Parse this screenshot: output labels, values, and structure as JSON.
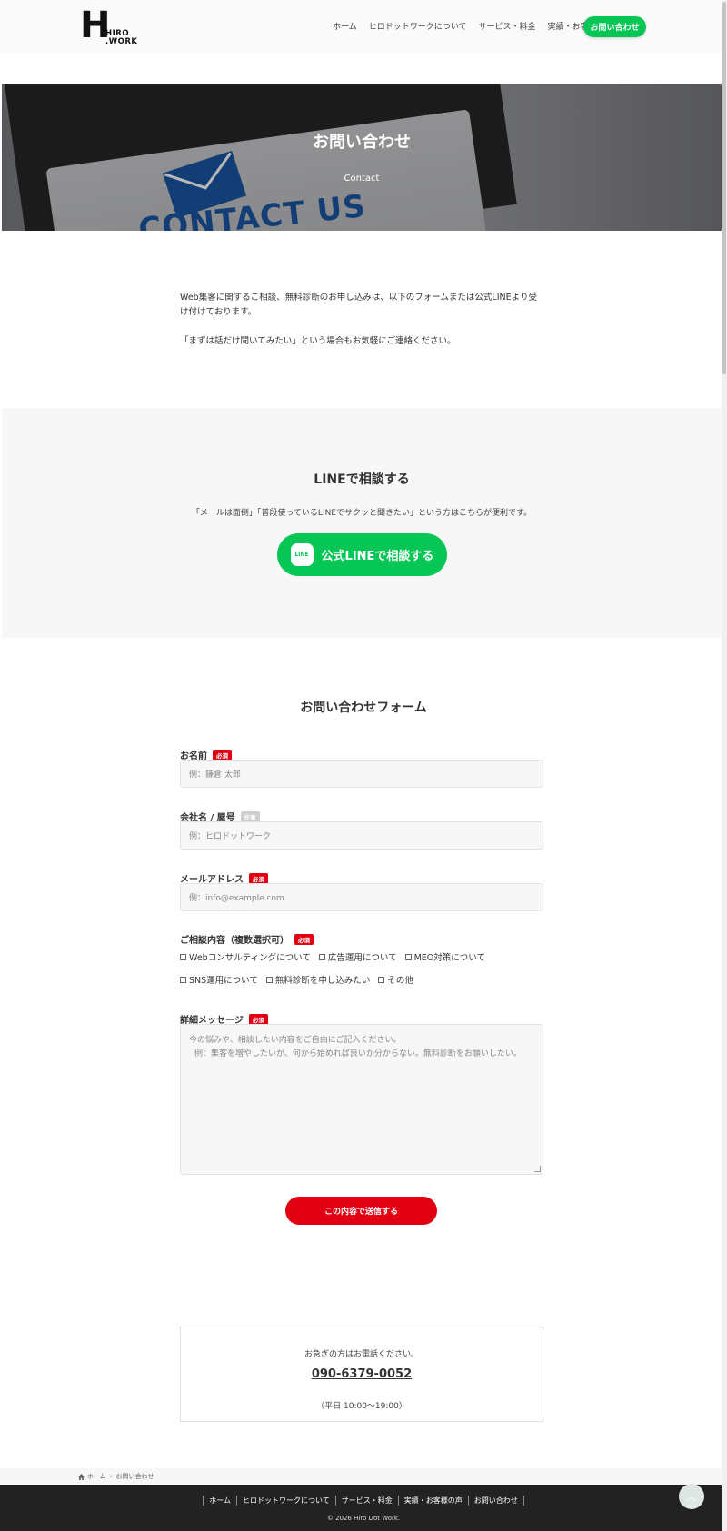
{
  "header": {
    "logo_sub": "HIRO\n.WORK",
    "nav": [
      "ホーム",
      "ヒロドットワークについて",
      "サービス・料金",
      "実績・お客様の声"
    ],
    "cta": "お問い合わせ"
  },
  "hero": {
    "title": "お問い合わせ",
    "subtitle": "Contact",
    "image_text": "CONTACT US"
  },
  "intro": {
    "p1": "Web集客に関するご相談、無料診断のお申し込みは、以下のフォームまたは公式LINEより受け付けております。",
    "p2": "「まずは話だけ聞いてみたい」という場合もお気軽にご連絡ください。"
  },
  "line": {
    "heading": "LINEで相談する",
    "desc": "「メールは面倒」「普段使っているLINEでサクッと聞きたい」という方はこちらが便利です。",
    "button": "公式LINEで相談する",
    "icon_text": "LINE"
  },
  "form": {
    "title": "お問い合わせフォーム",
    "required": "必須",
    "optional": "任意",
    "name_label": "お名前",
    "name_placeholder": "例：鎌倉 太郎",
    "company_label": "会社名 / 屋号",
    "company_placeholder": "例：ヒロドットワーク",
    "email_label": "メールアドレス",
    "email_placeholder": "例：info@example.com",
    "topics_label": "ご相談内容（複数選択可）",
    "topics": [
      "Webコンサルティングについて",
      "広告運用について",
      "MEO対策について",
      "SNS運用について",
      "無料診断を申し込みたい",
      "その他"
    ],
    "message_label": "詳細メッセージ",
    "message_placeholder_1": "今の悩みや、相談したい内容をご自由にご記入ください。",
    "message_placeholder_2": "例：集客を増やしたいが、何から始めれば良いか分からない。無料診断をお願いしたい。",
    "submit": "この内容で送信する"
  },
  "phone": {
    "line1": "お急ぎの方はお電話ください。",
    "number": "090-6379-0052",
    "hours": "（平日 10:00〜19:00）"
  },
  "breadcrumb": [
    "ホーム",
    "お問い合わせ"
  ],
  "footer": {
    "nav": [
      "ホーム",
      "ヒロドットワークについて",
      "サービス・料金",
      "実績・お客様の声",
      "お問い合わせ"
    ],
    "copyright": "© 2026 Hiro Dot Work."
  },
  "colors": {
    "line_green": "#06c755",
    "required_red": "#e00012",
    "footer_bg": "#222222"
  }
}
